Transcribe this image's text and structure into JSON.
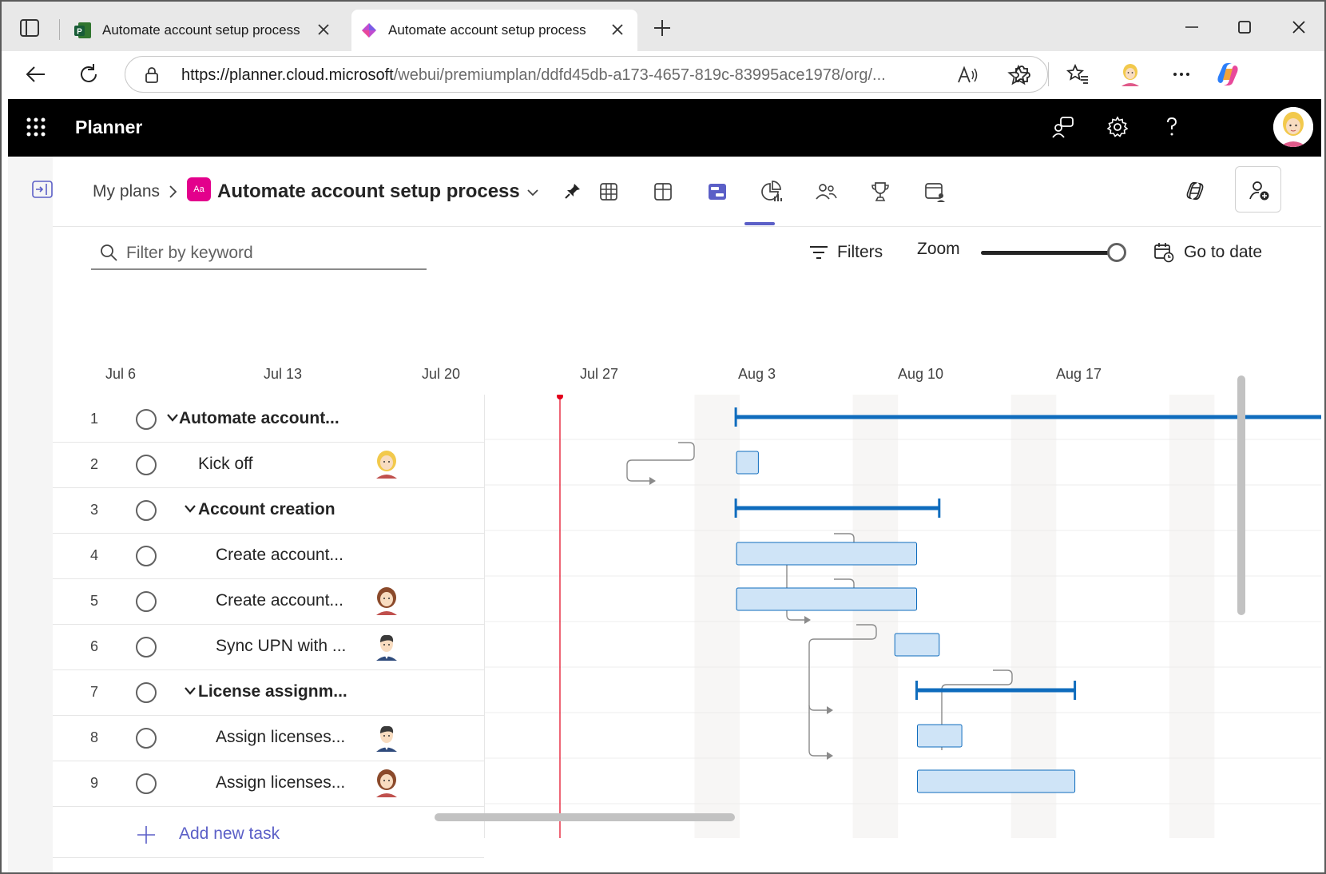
{
  "browser": {
    "tabs": [
      {
        "title": "Automate account setup process",
        "active": false,
        "icon": "project-icon"
      },
      {
        "title": "Automate account setup process",
        "active": true,
        "icon": "planner-icon"
      }
    ],
    "url_host": "https://planner.cloud.microsoft",
    "url_path": "/webui/premiumplan/ddfd45db-a173-4657-819c-83995ace1978/org/..."
  },
  "app": {
    "name": "Planner",
    "icons": [
      "feedback-icon",
      "settings-icon",
      "help-icon",
      "profile-avatar"
    ]
  },
  "plan": {
    "breadcrumb": "My plans",
    "badge": "Aa",
    "title": "Automate account setup process",
    "views": [
      "grid-view-icon",
      "board-view-icon",
      "timeline-view-icon",
      "charts-view-icon",
      "people-view-icon",
      "goals-view-icon",
      "assigned-to-me-view-icon"
    ],
    "active_view": "timeline-view-icon"
  },
  "filterbar": {
    "search_placeholder": "Filter by keyword",
    "filters_label": "Filters",
    "zoom_label": "Zoom",
    "zoom_level": 1.0,
    "goto_label": "Go to date"
  },
  "timeline": {
    "dates": [
      "Jul 6",
      "Jul 13",
      "Jul 20",
      "Jul 27",
      "Aug 3",
      "Aug 10",
      "Aug 17"
    ],
    "accent": "#0f6cbd",
    "bar_fill": "#cfe4f7",
    "today_color": "#e3001b"
  },
  "tasks": [
    {
      "num": "1",
      "name": "Automate account...",
      "summary": true,
      "indent": 0,
      "avatar": ""
    },
    {
      "num": "2",
      "name": "Kick off",
      "summary": false,
      "indent": 1,
      "avatar": "avatar-blonde"
    },
    {
      "num": "3",
      "name": "Account creation",
      "summary": true,
      "indent": 1,
      "avatar": ""
    },
    {
      "num": "4",
      "name": "Create account...",
      "summary": false,
      "indent": 2,
      "avatar": ""
    },
    {
      "num": "5",
      "name": "Create account...",
      "summary": false,
      "indent": 2,
      "avatar": "avatar-brunette"
    },
    {
      "num": "6",
      "name": "Sync UPN with ...",
      "summary": false,
      "indent": 2,
      "avatar": "avatar-man"
    },
    {
      "num": "7",
      "name": "License assignm...",
      "summary": true,
      "indent": 1,
      "avatar": ""
    },
    {
      "num": "8",
      "name": "Assign licenses...",
      "summary": false,
      "indent": 2,
      "avatar": "avatar-man"
    },
    {
      "num": "9",
      "name": "Assign licenses...",
      "summary": false,
      "indent": 2,
      "avatar": "avatar-brunette"
    }
  ],
  "add_task_label": "Add new task"
}
